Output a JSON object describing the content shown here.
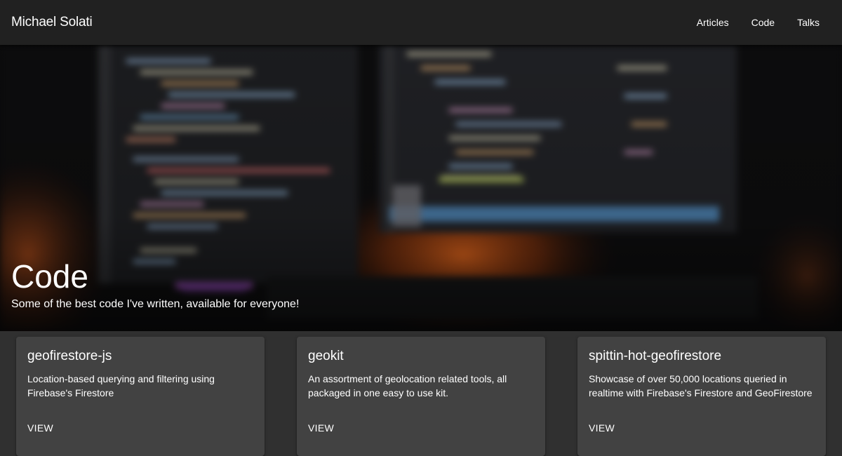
{
  "header": {
    "brand": "Michael Solati",
    "nav": [
      {
        "label": "Articles"
      },
      {
        "label": "Code"
      },
      {
        "label": "Talks"
      }
    ]
  },
  "hero": {
    "title": "Code",
    "subtitle": "Some of the best code I've written, available for everyone!"
  },
  "cards": [
    {
      "title": "geofirestore-js",
      "description": "Location-based querying and filtering using Firebase's Firestore",
      "action": "VIEW"
    },
    {
      "title": "geokit",
      "description": "An assortment of geolocation related tools, all packaged in one easy to use kit.",
      "action": "VIEW"
    },
    {
      "title": "spittin-hot-geofirestore",
      "description": "Showcase of over 50,000 locations queried in realtime with Firebase's Firestore and GeoFirestore",
      "action": "VIEW"
    }
  ],
  "colors": {
    "toolbar": "#212121",
    "page_background": "#303030",
    "card_background": "#424242",
    "text": "#ffffff"
  }
}
